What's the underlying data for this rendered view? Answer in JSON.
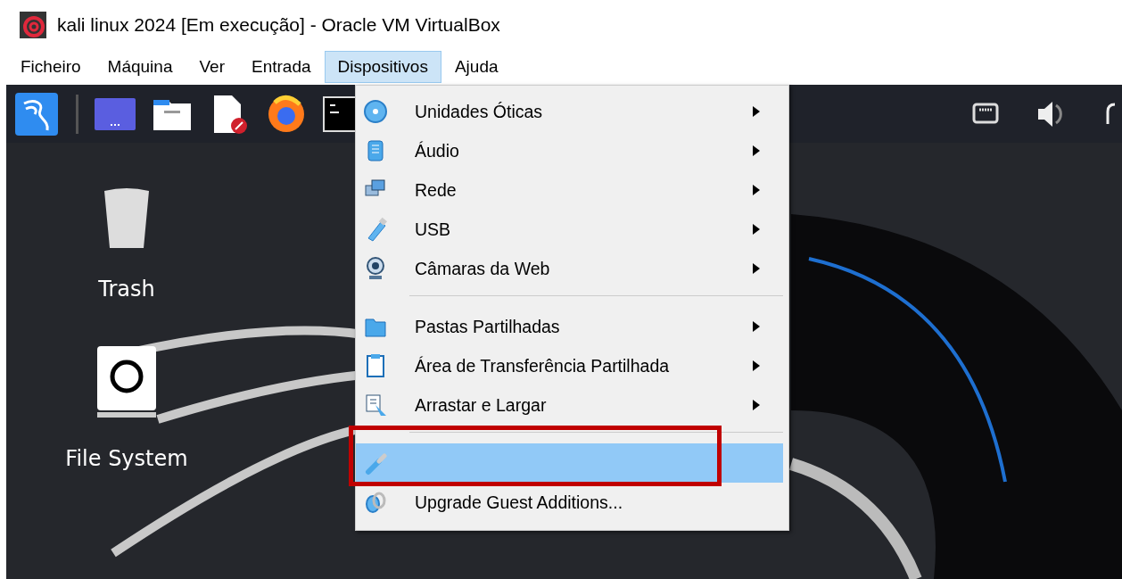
{
  "window": {
    "title": "kali linux 2024 [Em execução] - Oracle VM VirtualBox"
  },
  "menu_bar": [
    {
      "label": "Ficheiro",
      "selected": false
    },
    {
      "label": "Máquina",
      "selected": false
    },
    {
      "label": "Ver",
      "selected": false
    },
    {
      "label": "Entrada",
      "selected": false
    },
    {
      "label": "Dispositivos",
      "selected": true
    },
    {
      "label": "Ajuda",
      "selected": false
    }
  ],
  "desktop_icons": [
    {
      "label": "Trash",
      "kind": "trash"
    },
    {
      "label": "File System",
      "kind": "drive"
    }
  ],
  "devices_menu": [
    {
      "kind": "item",
      "label": "Unidades Óticas",
      "has_submenu": true,
      "selected": false
    },
    {
      "kind": "item",
      "label": "Áudio",
      "has_submenu": true,
      "selected": false
    },
    {
      "kind": "item",
      "label": "Rede",
      "has_submenu": true,
      "selected": false
    },
    {
      "kind": "item",
      "label": "USB",
      "has_submenu": true,
      "selected": false
    },
    {
      "kind": "item",
      "label": "Câmaras da Web",
      "has_submenu": true,
      "selected": false
    },
    {
      "kind": "separator"
    },
    {
      "kind": "item",
      "label": "Pastas Partilhadas",
      "has_submenu": true,
      "selected": false
    },
    {
      "kind": "item",
      "label": "Área de Transferência Partilhada",
      "has_submenu": true,
      "selected": false
    },
    {
      "kind": "item",
      "label": "Arrastar e Largar",
      "has_submenu": true,
      "selected": false
    },
    {
      "kind": "separator"
    },
    {
      "kind": "item",
      "has_submenu": false,
      "selected": true,
      "highlighted_box": true
    },
    {
      "kind": "item",
      "label": "Upgrade Guest Additions...",
      "has_submenu": false,
      "selected": false
    }
  ]
}
